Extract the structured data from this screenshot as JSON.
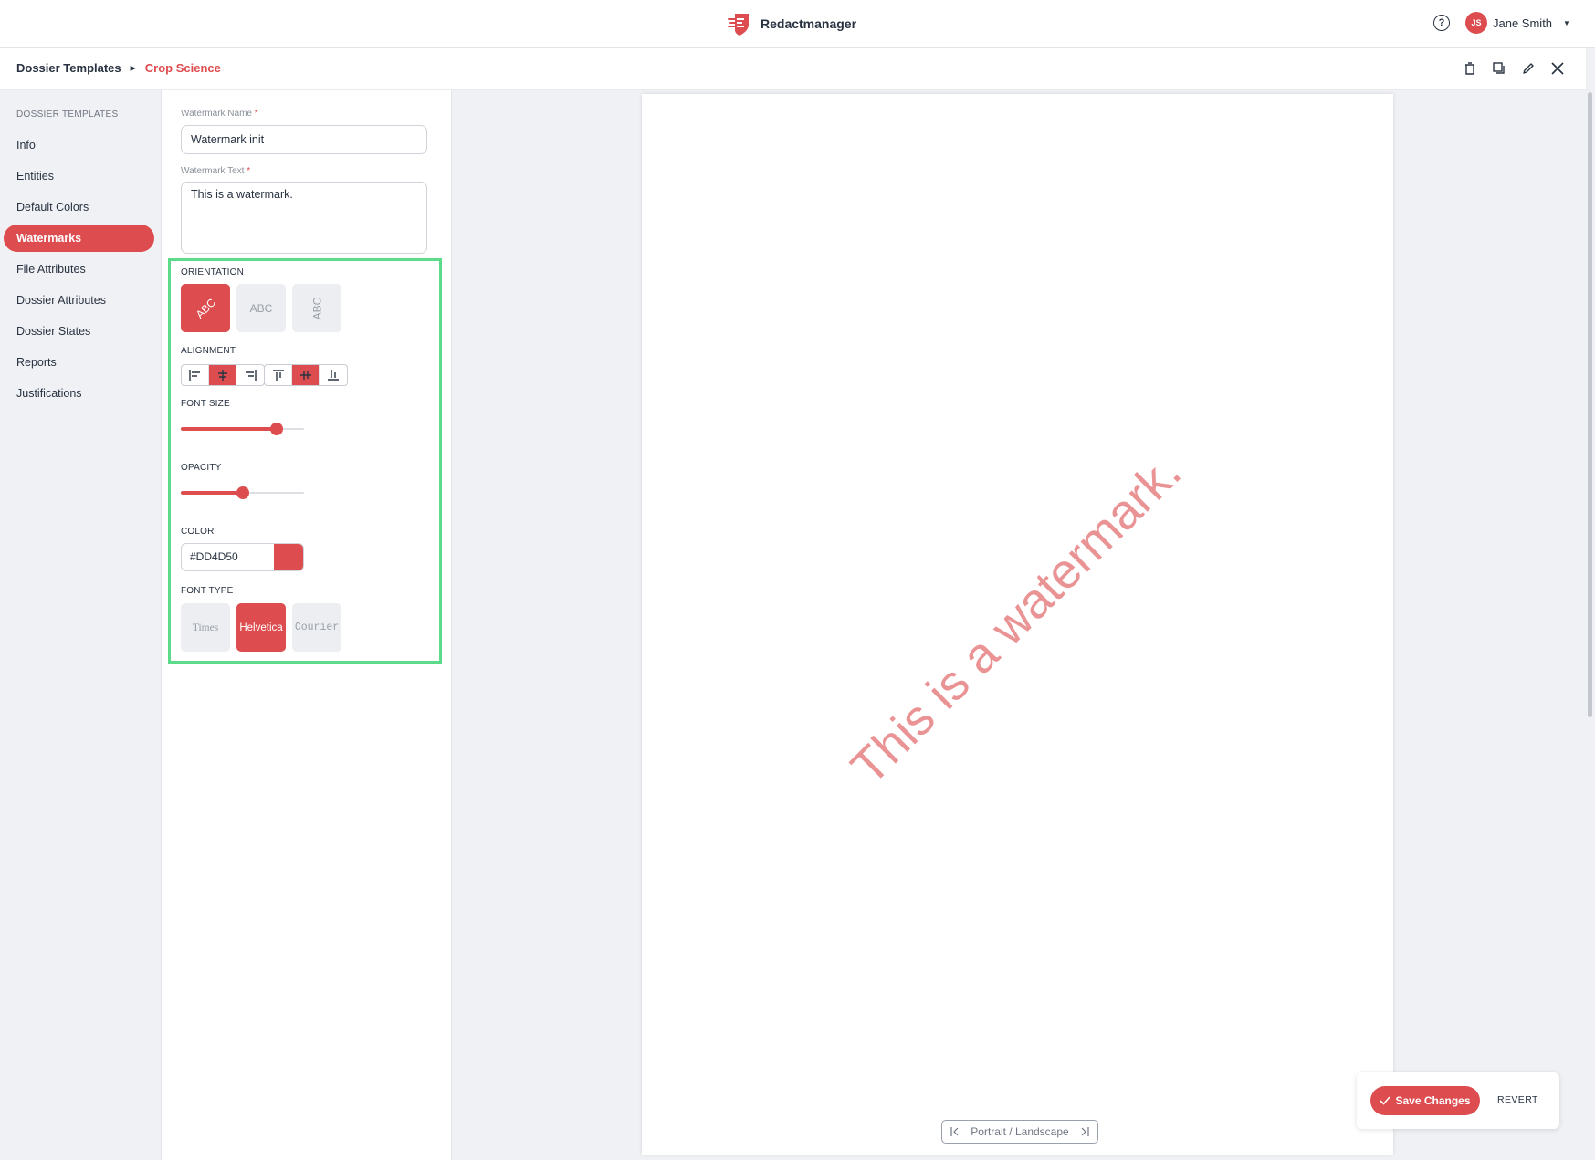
{
  "app": {
    "name": "Redactmanager"
  },
  "user": {
    "initials": "JS",
    "name": "Jane Smith"
  },
  "breadcrumb": {
    "root": "Dossier Templates",
    "current": "Crop Science"
  },
  "nav": {
    "heading": "DOSSIER TEMPLATES",
    "items": [
      {
        "label": "Info"
      },
      {
        "label": "Entities"
      },
      {
        "label": "Default Colors"
      },
      {
        "label": "Watermarks",
        "active": true
      },
      {
        "label": "File Attributes"
      },
      {
        "label": "Dossier Attributes"
      },
      {
        "label": "Dossier States"
      },
      {
        "label": "Reports"
      },
      {
        "label": "Justifications"
      }
    ]
  },
  "form": {
    "name_label": "Watermark Name",
    "name_value": "Watermark init",
    "text_label": "Watermark Text",
    "text_value": "This is a watermark.",
    "required_mark": "*",
    "orientation_label": "ORIENTATION",
    "orientation_options": [
      "ABC",
      "ABC",
      "ABC"
    ],
    "orientation_selected": "diagonal",
    "alignment_label": "ALIGNMENT",
    "horizontal_alignment": "center",
    "vertical_alignment": "middle",
    "font_size_label": "FONT SIZE",
    "font_size_fraction": 0.78,
    "opacity_label": "OPACITY",
    "opacity_fraction": 0.5,
    "color_label": "COLOR",
    "color_value": "#DD4D50",
    "font_type_label": "FONT TYPE",
    "font_types": [
      "Times",
      "Helvetica",
      "Courier"
    ],
    "font_type_selected": "Helvetica"
  },
  "preview": {
    "watermark_text": "This is a watermark.",
    "watermark_color": "#dd4d50",
    "watermark_opacity": 0.6,
    "toggle_label": "Portrait / Landscape"
  },
  "actions": {
    "save_label": "Save Changes",
    "revert_label": "REVERT"
  },
  "colors": {
    "accent": "#dd4d50",
    "highlight_border": "#5cdc8b",
    "text": "#283241"
  }
}
